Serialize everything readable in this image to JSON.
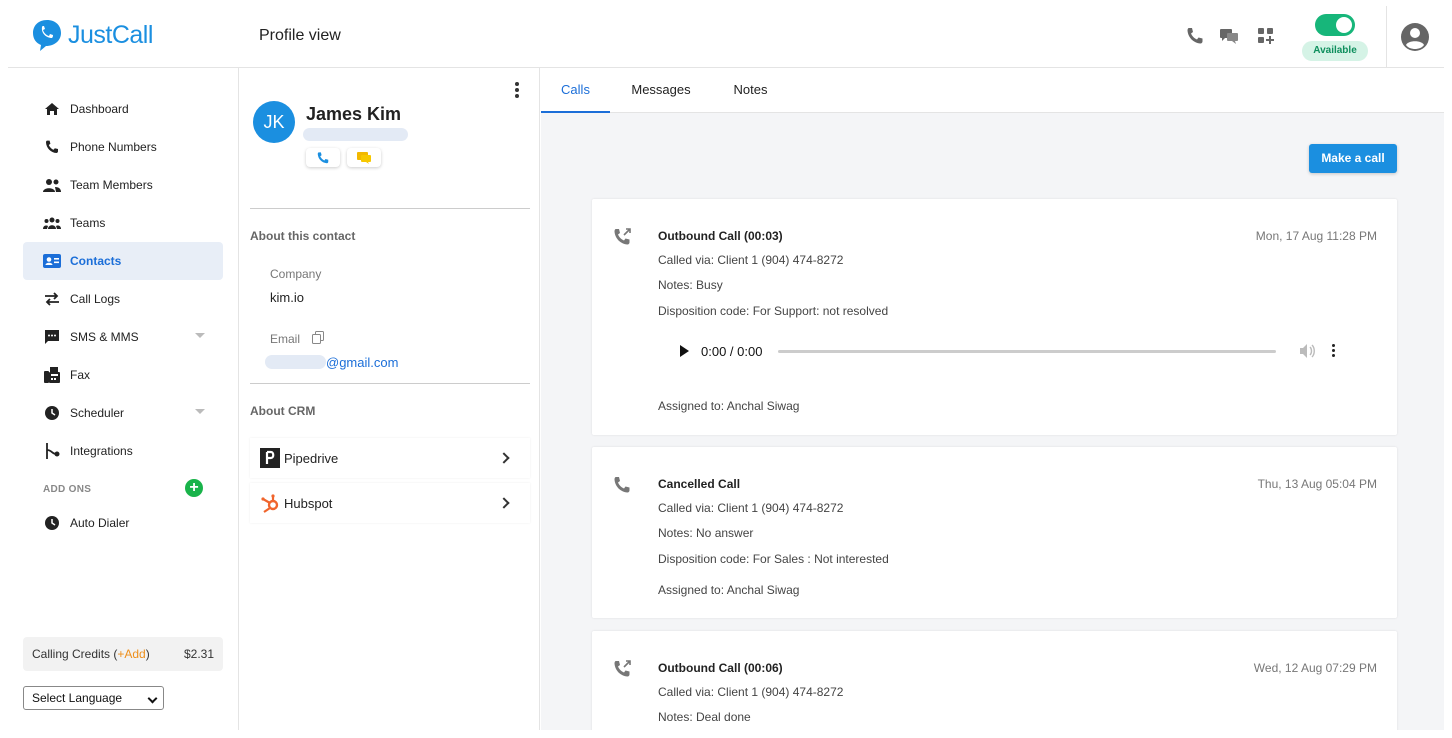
{
  "app": {
    "name": "JustCall",
    "page_title": "Profile view"
  },
  "header": {
    "status_label": "Available"
  },
  "sidebar": {
    "items": [
      {
        "label": "Dashboard",
        "icon": "home-icon"
      },
      {
        "label": "Phone Numbers",
        "icon": "phone-icon"
      },
      {
        "label": "Team Members",
        "icon": "people-icon"
      },
      {
        "label": "Teams",
        "icon": "group-icon"
      },
      {
        "label": "Contacts",
        "icon": "contact-card-icon",
        "active": true
      },
      {
        "label": "Call Logs",
        "icon": "swap-arrows-icon"
      },
      {
        "label": "SMS & MMS",
        "icon": "chat-icon",
        "dropdown": true
      },
      {
        "label": "Fax",
        "icon": "fax-icon"
      },
      {
        "label": "Scheduler",
        "icon": "clock-icon",
        "dropdown": true
      },
      {
        "label": "Integrations",
        "icon": "integration-icon"
      }
    ],
    "addons_label": "ADD ONS",
    "addon_items": [
      {
        "label": "Auto Dialer",
        "icon": "clock-icon"
      }
    ],
    "credits": {
      "label": "Calling Credits (",
      "add": "+Add",
      "close": ")",
      "amount": "$2.31"
    },
    "language": "Select Language"
  },
  "contact": {
    "initials": "JK",
    "name": "James Kim",
    "about_title": "About this contact",
    "company_label": "Company",
    "company_value": "kim.io",
    "email_label": "Email",
    "email_value": "@gmail.com",
    "crm_title": "About CRM",
    "crm_items": [
      {
        "label": "Pipedrive"
      },
      {
        "label": "Hubspot"
      }
    ]
  },
  "main": {
    "tabs": [
      {
        "label": "Calls",
        "active": true
      },
      {
        "label": "Messages"
      },
      {
        "label": "Notes"
      }
    ],
    "make_call_label": "Make a call",
    "audio_time": "0:00 / 0:00",
    "calls": [
      {
        "title": "Outbound Call (00:03)",
        "date": "Mon, 17 Aug 11:28 PM",
        "via": "Called via: Client 1 (904) 474-8272",
        "notes": "Notes: Busy",
        "disposition": "Disposition code: For Support: not resolved",
        "assigned": "Assigned to: Anchal Siwag"
      },
      {
        "title": "Cancelled Call",
        "date": "Thu, 13 Aug 05:04 PM",
        "via": "Called via: Client 1 (904) 474-8272",
        "notes": "Notes: No answer",
        "disposition": "Disposition code: For Sales : Not interested",
        "assigned": "Assigned to: Anchal Siwag"
      },
      {
        "title": "Outbound Call (00:06)",
        "date": "Wed, 12 Aug 07:29 PM",
        "via": "Called via: Client 1 (904) 474-8272",
        "notes": "Notes: Deal done"
      }
    ]
  },
  "colors": {
    "brand": "#1b8fe0",
    "active_text": "#1b6ed8",
    "available": "#17b67a",
    "addon_green": "#19b34a",
    "credit_add": "#ee8f1b"
  }
}
